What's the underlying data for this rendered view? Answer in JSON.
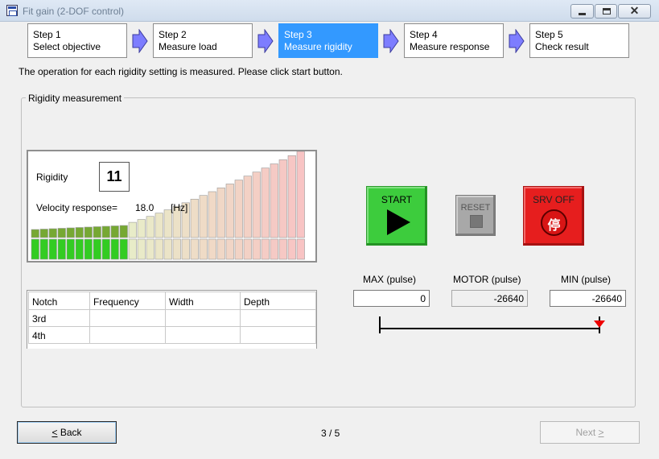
{
  "window": {
    "title": "Fit gain (2-DOF control)"
  },
  "steps": [
    {
      "num": "Step 1",
      "label": "Select objective",
      "active": false
    },
    {
      "num": "Step 2",
      "label": "Measure load",
      "active": false
    },
    {
      "num": "Step 3",
      "label": "Measure rigidity",
      "active": true
    },
    {
      "num": "Step 4",
      "label": "Measure response",
      "active": false
    },
    {
      "num": "Step 5",
      "label": "Check result",
      "active": false
    }
  ],
  "instruction": "The operation for each rigidity setting is measured. Please click start button.",
  "group_title": "Rigidity measurement",
  "rigidity": {
    "label": "Rigidity",
    "value": "11",
    "velocity_label": "Velocity response=",
    "velocity_value": "18.0",
    "velocity_unit": "[Hz]",
    "total_levels": 31,
    "measured_levels": 11,
    "colors": {
      "measured_top": "#76a833",
      "measured_bottom": "#33cc22",
      "pending_low": "#e8ecc8",
      "pending_high": "#f8c4c4"
    }
  },
  "notch_table": {
    "headers": [
      "Notch",
      "Frequency",
      "Width",
      "Depth"
    ],
    "rows": [
      [
        "3rd",
        "",
        "",
        ""
      ],
      [
        "4th",
        "",
        "",
        ""
      ]
    ]
  },
  "buttons": {
    "start": "START",
    "reset": "RESET",
    "servo_off": "SRV OFF",
    "servo_off_glyph": "停"
  },
  "pulse": {
    "max_label": "MAX (pulse)",
    "motor_label": "MOTOR (pulse)",
    "min_label": "MIN (pulse)",
    "max_value": "0",
    "motor_value": "-26640",
    "min_value": "-26640"
  },
  "footer": {
    "back_label": "< Back",
    "page": "3 / 5",
    "next_label": "Next >"
  }
}
